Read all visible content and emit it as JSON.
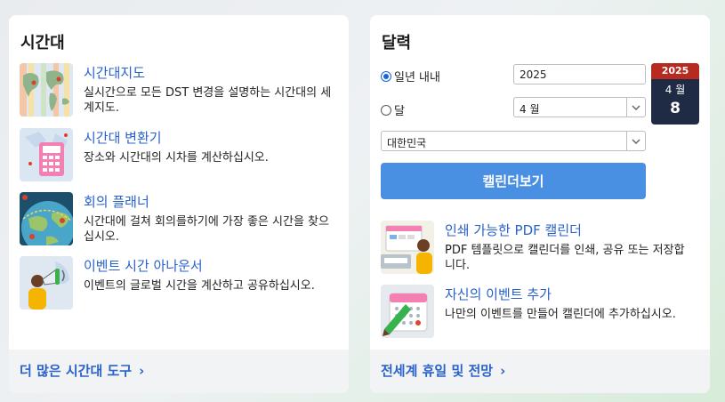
{
  "timezone_card": {
    "title": "시간대",
    "tools": [
      {
        "title": "시간대지도",
        "desc": "실시간으로 모든 DST 변경을 설명하는 시간대의 세계지도.",
        "icon": "world-map-icon"
      },
      {
        "title": "시간대 변환기",
        "desc": "장소와 시간대의 시차를 계산하십시오.",
        "icon": "calculator-icon"
      },
      {
        "title": "회의 플래너",
        "desc": "시간대에 걸쳐 회의를하기에 가장 좋은 시간을 찾으십시오.",
        "icon": "globe-pins-icon"
      },
      {
        "title": "이벤트 시간 아나운서",
        "desc": "이벤트의 글로벌 시간을 계산하고 공유하십시오.",
        "icon": "megaphone-icon"
      }
    ],
    "footer_link": "더 많은 시간대 도구",
    "footer_chevron": "›"
  },
  "calendar_card": {
    "title": "달력",
    "radio_year_label": "일년 내내",
    "radio_month_label": "달",
    "year_value": "2025",
    "month_value": "4 월",
    "country_value": "대한민국",
    "badge": {
      "year": "2025",
      "month": "4 월",
      "day": "8"
    },
    "view_button": "캘린더보기",
    "tools": [
      {
        "title": "인쇄 가능한 PDF 캘린더",
        "desc": "PDF 템플릿으로 캘린더를 인쇄, 공유 또는 저장합니다.",
        "icon": "printer-calendar-icon"
      },
      {
        "title": "자신의 이벤트 추가",
        "desc": "나만의 이벤트를 만들어 캘린더에 추가하십시오.",
        "icon": "calendar-pencil-icon"
      }
    ],
    "footer_link": "전세계 휴일 및 전망",
    "footer_chevron": "›"
  },
  "colors": {
    "link": "#2a62c9",
    "button": "#4a90e2",
    "badge_top": "#b72a1f",
    "badge_body": "#1f2a44"
  }
}
